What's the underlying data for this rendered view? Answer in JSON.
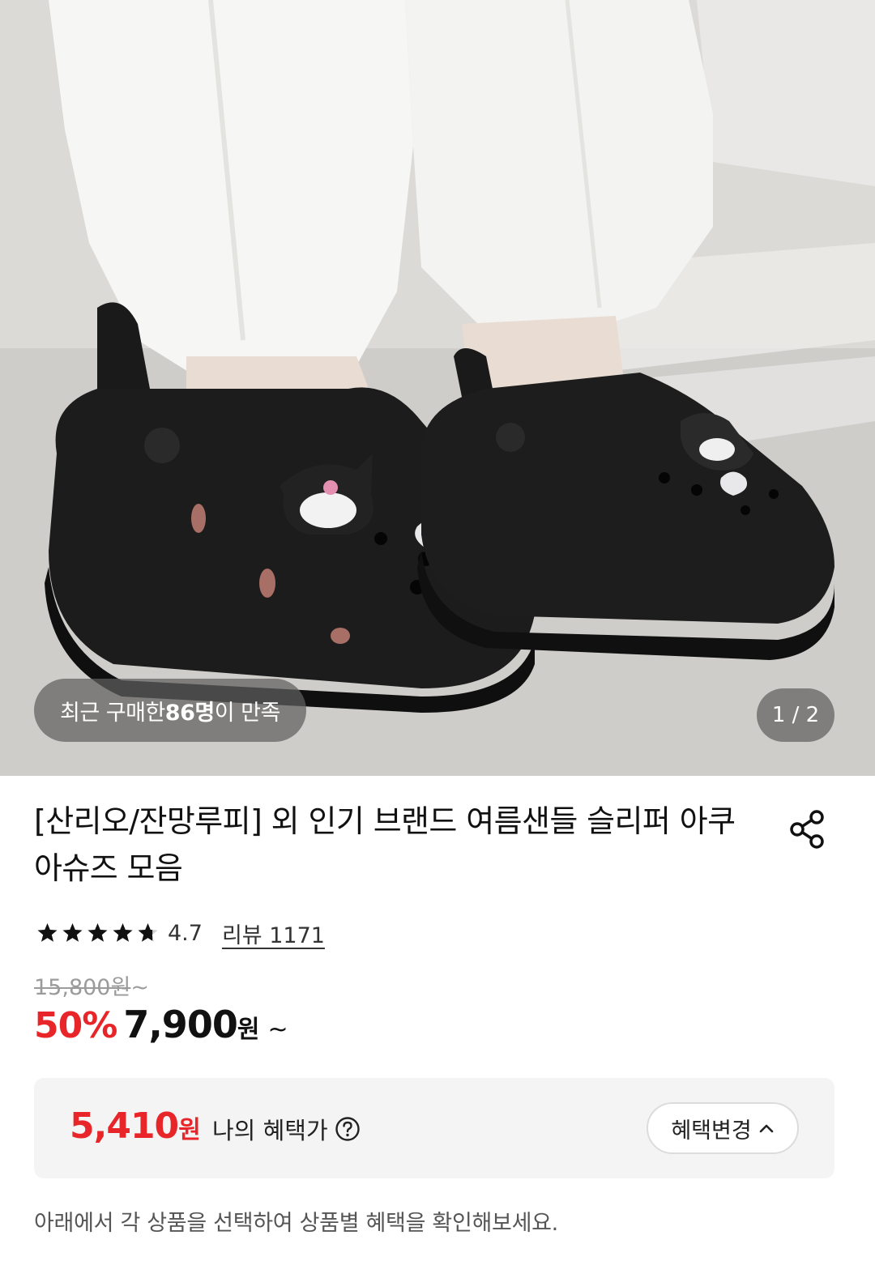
{
  "gallery": {
    "badge_prefix": "최근 구매한 ",
    "badge_count": "86명",
    "badge_suffix": "이 만족",
    "page_indicator": "1 / 2",
    "image_alt": "black platform clog sandals with character charms"
  },
  "product": {
    "title": "[산리오/잔망루피] 외 인기 브랜드 여름샌들 슬리퍼 아쿠아슈즈 모음",
    "rating": "4.7",
    "rating_stars": 4.7,
    "review_link": "리뷰 1171",
    "original_price": "15,800원",
    "original_tilde": "~",
    "discount": "50%",
    "sale_price": "7,900",
    "sale_unit": "원",
    "sale_tilde": "~"
  },
  "benefit": {
    "price": "5,410",
    "unit": "원",
    "label": "나의 혜택가",
    "change_button": "혜택변경",
    "hint": "아래에서 각 상품을 선택하여 상품별 혜택을 확인해보세요."
  },
  "colors": {
    "accent_red": "#e8262a",
    "benefit_bg": "#f4f4f4"
  },
  "icons": [
    "share-icon",
    "star-icon",
    "help-circle-icon",
    "chevron-up-icon"
  ]
}
